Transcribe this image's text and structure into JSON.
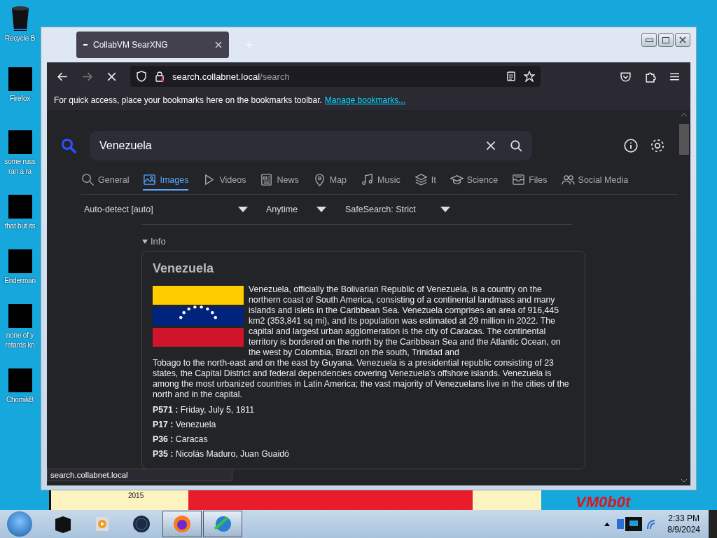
{
  "desktop": {
    "icons": [
      {
        "kind": "bin",
        "lines": [
          "Recycle B"
        ]
      },
      {
        "kind": "block",
        "lines": [
          "Firefox"
        ]
      },
      {
        "kind": "block",
        "lines": [
          "some russ",
          "ran a ra"
        ]
      },
      {
        "kind": "block",
        "lines": [
          "that but its"
        ]
      },
      {
        "kind": "block",
        "lines": [
          "Enderman"
        ]
      },
      {
        "kind": "block",
        "lines": [
          "none of y",
          "retards kn"
        ]
      },
      {
        "kind": "block",
        "lines": [
          "ChomikB"
        ]
      }
    ],
    "wallpaper_texts": [
      "2015",
      "VM0b0t"
    ]
  },
  "browser": {
    "tab": {
      "title": "CollabVM SearXNG",
      "selected": true
    },
    "url": {
      "host": "search.collabnet.local",
      "path": "/search"
    },
    "bookmarks_bar": {
      "message": "For quick access, place your bookmarks here on the bookmarks toolbar.",
      "link": "Manage bookmarks..."
    },
    "status_url": "search.collabnet.local"
  },
  "search": {
    "query": "Venezuela",
    "categories": [
      {
        "kind": "search",
        "label": "General",
        "selected": false
      },
      {
        "kind": "image",
        "label": "Images",
        "selected": true
      },
      {
        "kind": "play",
        "label": "Videos",
        "selected": false
      },
      {
        "kind": "news",
        "label": "News",
        "selected": false
      },
      {
        "kind": "pin",
        "label": "Map",
        "selected": false
      },
      {
        "kind": "music",
        "label": "Music",
        "selected": false
      },
      {
        "kind": "layers",
        "label": "It",
        "selected": false
      },
      {
        "kind": "cap",
        "label": "Science",
        "selected": false
      },
      {
        "kind": "box",
        "label": "Files",
        "selected": false
      },
      {
        "kind": "people",
        "label": "Social Media",
        "selected": false
      }
    ],
    "filters": [
      "Auto-detect [auto]",
      "Anytime",
      "SafeSearch: Strict"
    ],
    "info_toggle": {
      "label": "Info",
      "expanded": true
    },
    "infobox": {
      "title": "Venezuela",
      "text": [
        "Venezuela, officially the Bolivarian Republic of Venezuela, is a country on the northern coast of South America, consisting of a continental landmass and many islands and islets in the Caribbean Sea. Venezuela comprises an area of 916,445 km2 (353,841 sq mi), and its population was estimated at 29 million in 2022. The capital and largest urban agglomeration is the city of Caracas. The continental territory is bordered on the north by the Caribbean Sea and the Atlantic Ocean, on the west by Colombia, Brazil on the south, Trinidad and",
        "Tobago to the north-east and on the east by Guyana. Venezuela is a presidential republic consisting of 23 states, the Capital District and federal dependencies covering Venezuela's offshore islands. Venezuela is among the most urbanized countries in Latin America; the vast majority of Venezuelans live in the cities of the north and in the capital."
      ],
      "facts": [
        {
          "key": "P571 :",
          "value": "Friday, July 5, 1811"
        },
        {
          "key": "P17 :",
          "value": "Venezuela"
        },
        {
          "key": "P36 :",
          "value": "Caracas"
        },
        {
          "key": "P35 :",
          "value": "Nicolás Maduro, Juan Guaidó"
        }
      ]
    }
  },
  "taskbar": {
    "apps": [
      {
        "kind": "box",
        "active": false
      },
      {
        "kind": "media",
        "active": false
      },
      {
        "kind": "globe",
        "active": false
      },
      {
        "kind": "firefox",
        "active": true
      },
      {
        "kind": "network",
        "active": true
      }
    ],
    "time": "2:33 PM",
    "date": "8/9/2024"
  }
}
